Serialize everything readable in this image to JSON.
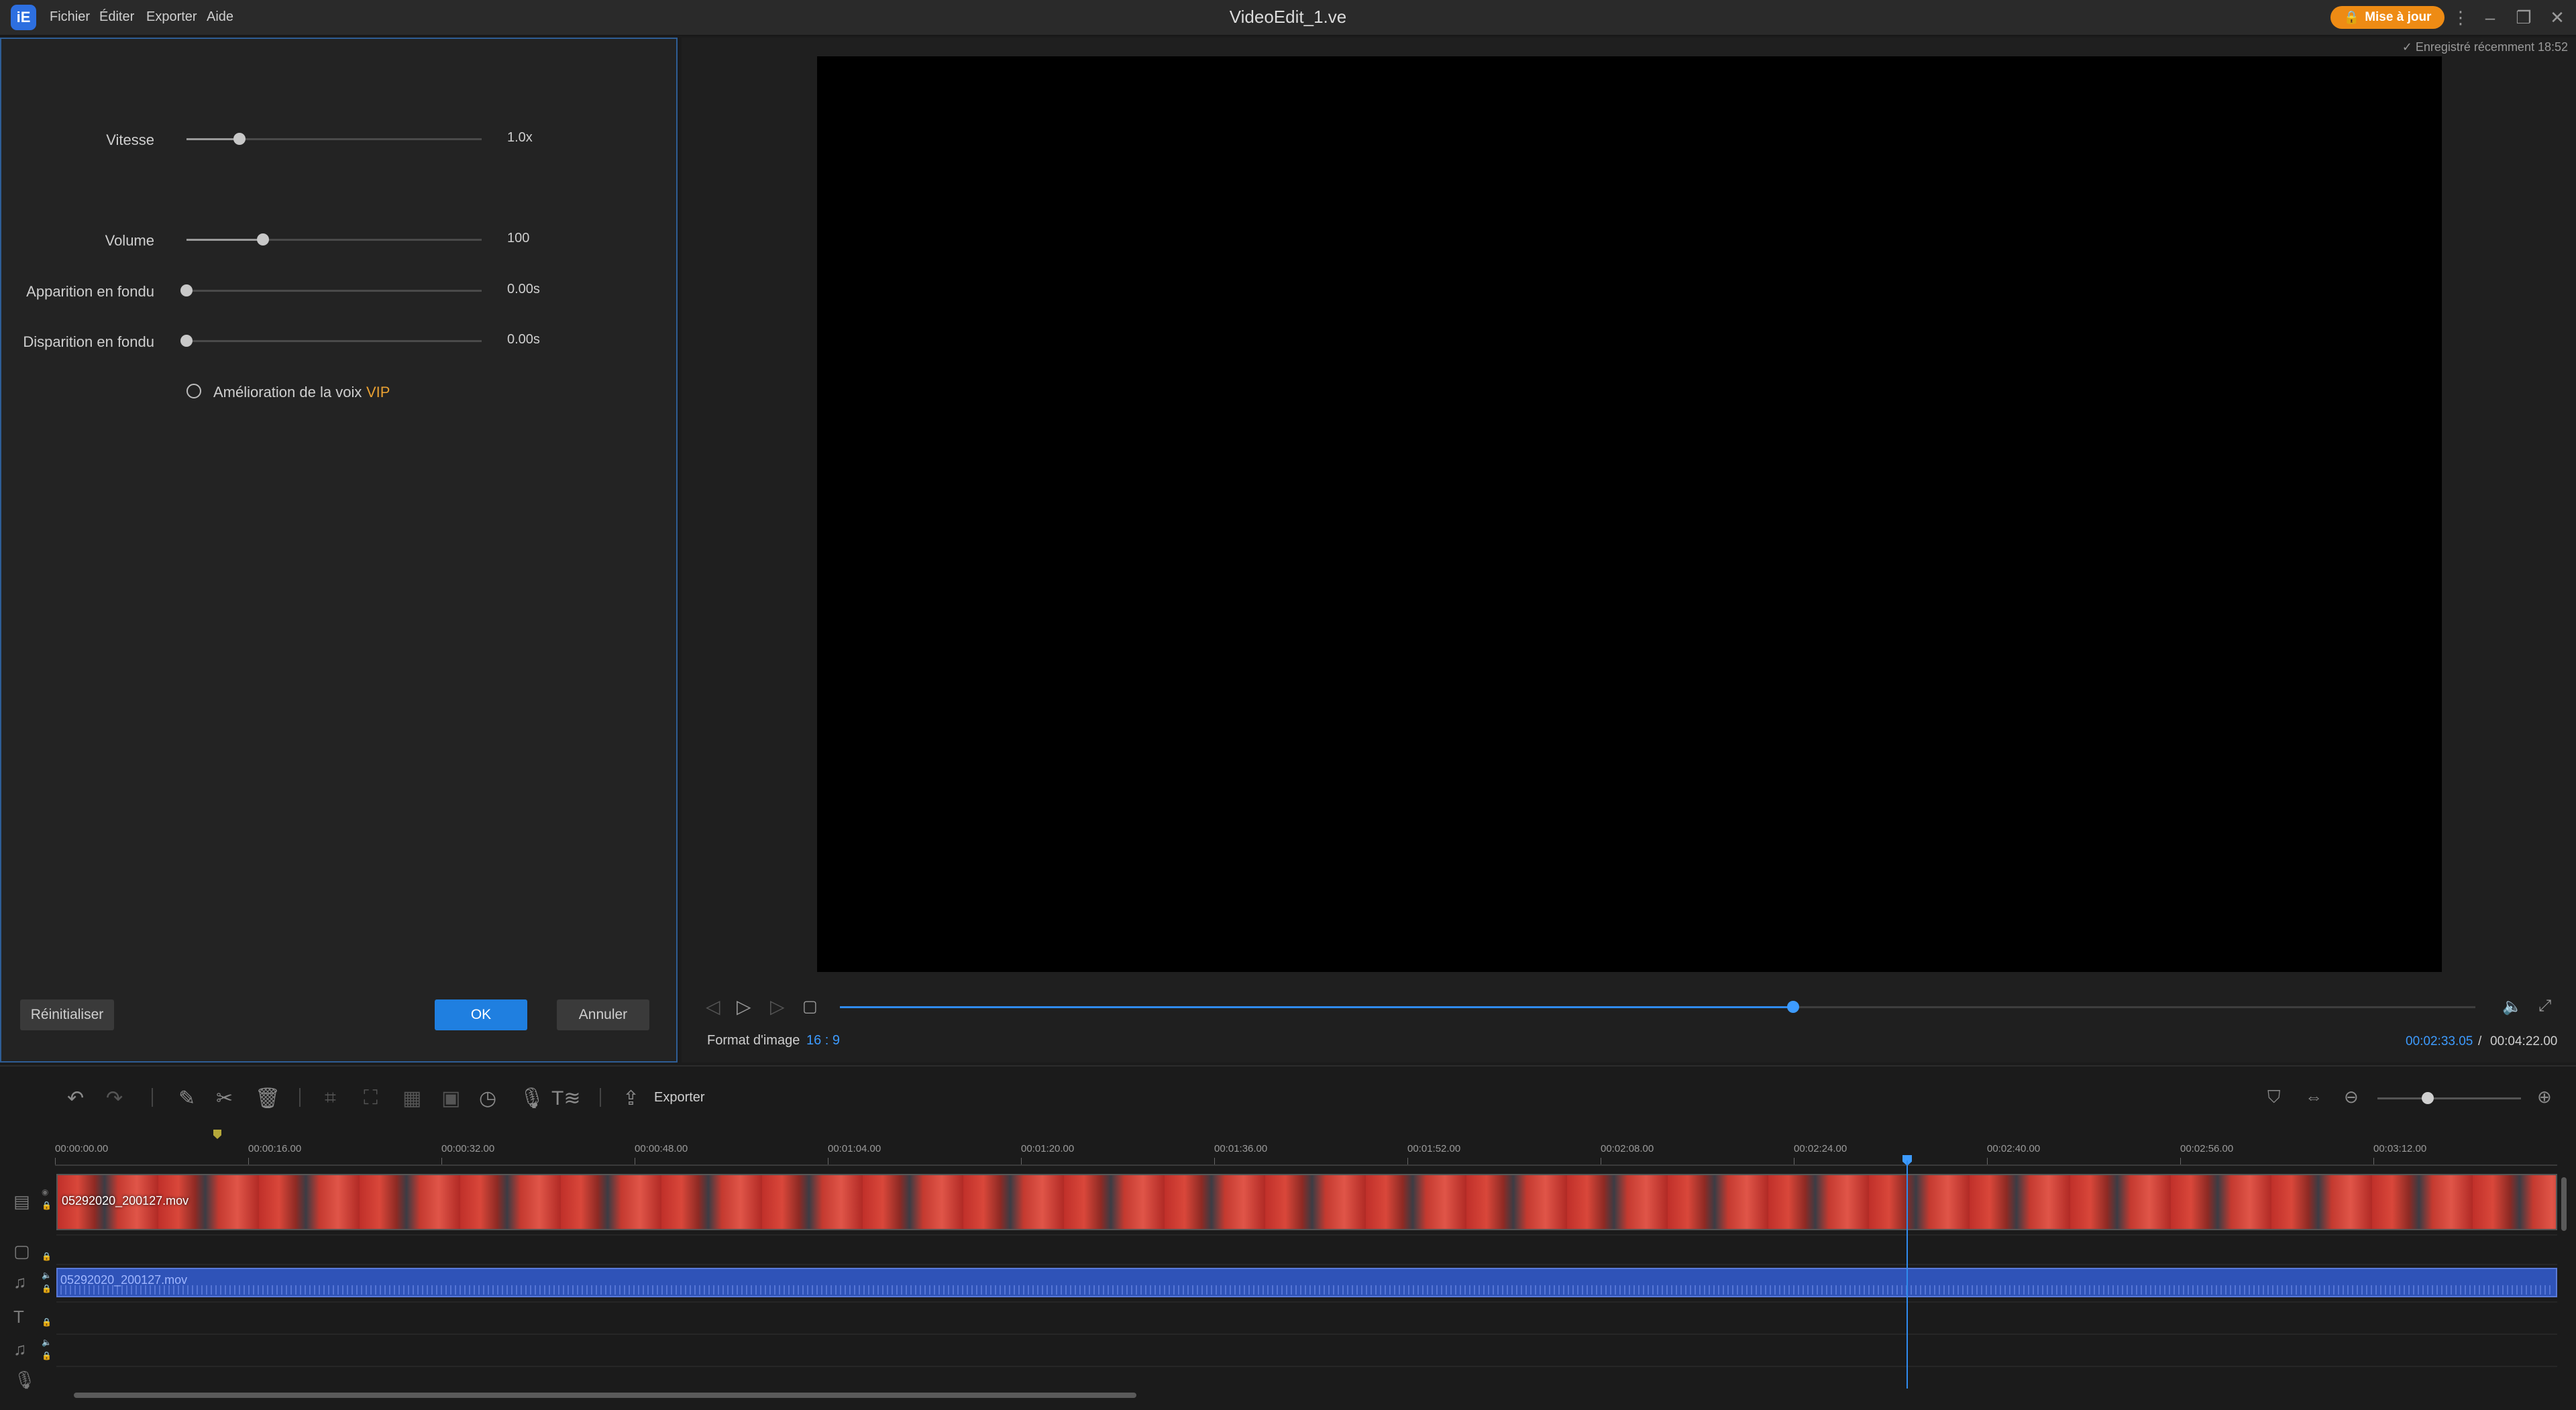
{
  "titlebar": {
    "app_logo": "iE",
    "menu": [
      "Fichier",
      "Éditer",
      "Exporter",
      "Aide"
    ],
    "title": "VideoEdit_1.ve",
    "upgrade_label": "Mise à jour",
    "upgrade_icon": "lock-icon",
    "controls": {
      "more": "⋮",
      "minimize": "–",
      "restore": "❐",
      "close": "✕"
    }
  },
  "settings": {
    "speed": {
      "label": "Vitesse",
      "value_text": "1.0x",
      "fraction": 0.18
    },
    "volume": {
      "label": "Volume",
      "value_text": "100",
      "fraction": 0.26
    },
    "fade_in": {
      "label": "Apparition en fondu",
      "value_text": "0.00s",
      "fraction": 0.0
    },
    "fade_out": {
      "label": "Disparition en fondu",
      "value_text": "0.00s",
      "fraction": 0.0
    },
    "voice_enhance": {
      "label": "Amélioration de la voix",
      "badge": "VIP",
      "checked": false
    },
    "reset_label": "Réinitialiser",
    "ok_label": "OK",
    "cancel_label": "Annuler"
  },
  "preview": {
    "saved_status": "Enregistré récemment 18:52",
    "aspect_label": "Format d'image",
    "aspect_value": "16 : 9",
    "progress_fraction": 0.583,
    "time_current": "00:02:33.05",
    "time_separator": "/",
    "time_total": "00:04:22.00"
  },
  "toolbar": {
    "export_label": "Exporter",
    "zoom_fraction": 0.35
  },
  "timeline": {
    "ticks": [
      "00:00:00.00",
      "00:00:16.00",
      "00:00:32.00",
      "00:00:48.00",
      "00:01:04.00",
      "00:01:20.00",
      "00:01:36.00",
      "00:01:52.00",
      "00:02:08.00",
      "00:02:24.00",
      "00:02:40.00",
      "00:02:56.00",
      "00:03:12.00"
    ],
    "video_clip": "05292020_200127.mov",
    "audio_clip": "05292020_200127.mov"
  }
}
